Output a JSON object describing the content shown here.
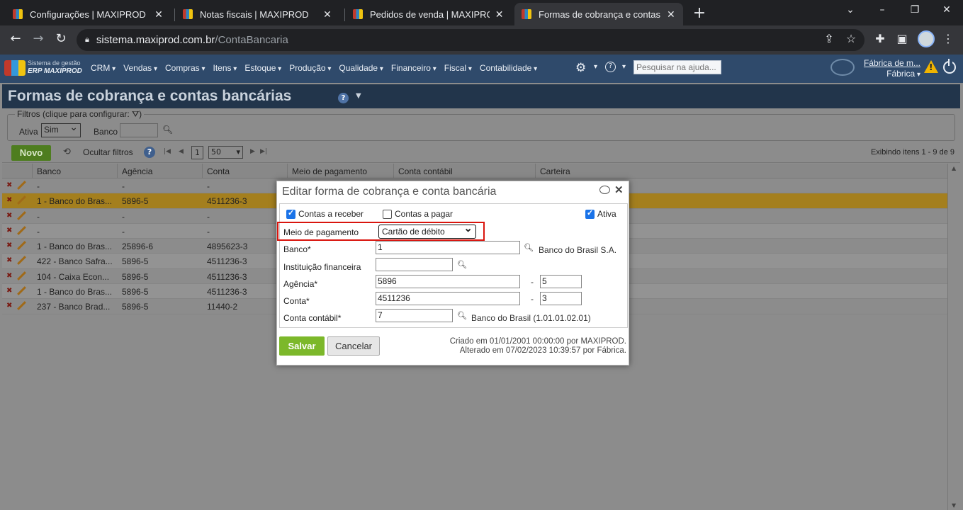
{
  "browser": {
    "tabs": [
      {
        "title": "Configurações | MAXIPROD",
        "active": false
      },
      {
        "title": "Notas fiscais | MAXIPROD",
        "active": false
      },
      {
        "title": "Pedidos de venda | MAXIPROD",
        "active": false
      },
      {
        "title": "Formas de cobrança e contas bar",
        "active": true
      }
    ],
    "url_host": "sistema.maxiprod.com.br",
    "url_path": "/ContaBancaria"
  },
  "app": {
    "logo_small": "Sistema de gestão",
    "logo_big": "ERP MAXIPROD",
    "menu": [
      "CRM",
      "Vendas",
      "Compras",
      "Itens",
      "Estoque",
      "Produção",
      "Qualidade",
      "Financeiro",
      "Fiscal",
      "Contabilidade"
    ],
    "help_glyph": "?",
    "search_placeholder": "Pesquisar na ajuda...",
    "company_name": "Fábrica de m...",
    "company_role": "Fábrica",
    "warning_glyph": "!"
  },
  "page": {
    "title": "Formas de cobrança e contas bancárias",
    "help_glyph": "?",
    "filters": {
      "legend": "Filtros (clique para configurar:",
      "legend_end": ")",
      "ativa_label": "Ativa",
      "ativa_value": "Sim",
      "banco_label": "Banco"
    },
    "toolbar": {
      "new_label": "Novo",
      "hide_filters_label": "Ocultar filtros",
      "help_glyph": "?",
      "page_number": "1",
      "page_size": "50",
      "displaying": "Exibindo itens 1 - 9 de 9"
    },
    "columns": [
      "Banco",
      "Agência",
      "Conta",
      "Meio de pagamento",
      "Conta contábil",
      "Carteira"
    ],
    "rows": [
      {
        "banco": "-",
        "agencia": "-",
        "conta": "-"
      },
      {
        "banco": "1 - Banco do Bras...",
        "agencia": "5896-5",
        "conta": "4511236-3"
      },
      {
        "banco": "-",
        "agencia": "-",
        "conta": "-"
      },
      {
        "banco": "-",
        "agencia": "-",
        "conta": "-"
      },
      {
        "banco": "1 - Banco do Bras...",
        "agencia": "25896-6",
        "conta": "4895623-3"
      },
      {
        "banco": "422 - Banco Safra...",
        "agencia": "5896-5",
        "conta": "4511236-3"
      },
      {
        "banco": "104 - Caixa Econ...",
        "agencia": "5896-5",
        "conta": "4511236-3"
      },
      {
        "banco": "1 - Banco do Bras...",
        "agencia": "5896-5",
        "conta": "4511236-3"
      },
      {
        "banco": "237 - Banco Brad...",
        "agencia": "5896-5",
        "conta": "11440-2"
      }
    ]
  },
  "dialog": {
    "title": "Editar forma de cobrança e conta bancária",
    "contas_receber_label": "Contas a receber",
    "contas_receber_checked": true,
    "contas_pagar_label": "Contas a pagar",
    "contas_pagar_checked": false,
    "ativa_label": "Ativa",
    "ativa_checked": true,
    "meio_pagamento_label": "Meio de pagamento",
    "meio_pagamento_value": "Cartão de débito",
    "banco_label": "Banco*",
    "banco_value": "1",
    "banco_desc": "Banco do Brasil S.A.",
    "instituicao_label": "Instituição financeira",
    "instituicao_value": "",
    "agencia_label": "Agência*",
    "agencia_value": "5896",
    "agencia_dv": "5",
    "conta_label": "Conta*",
    "conta_value": "4511236",
    "conta_dv": "3",
    "dash": "-",
    "conta_contabil_label": "Conta contábil*",
    "conta_contabil_value": "7",
    "conta_contabil_desc": "Banco do Brasil (1.01.01.02.01)",
    "save_label": "Salvar",
    "cancel_label": "Cancelar",
    "created": "Criado em 01/01/2001 00:00:00 por MAXIPROD.",
    "updated": "Alterado em 07/02/2023 10:39:57 por Fábrica."
  }
}
